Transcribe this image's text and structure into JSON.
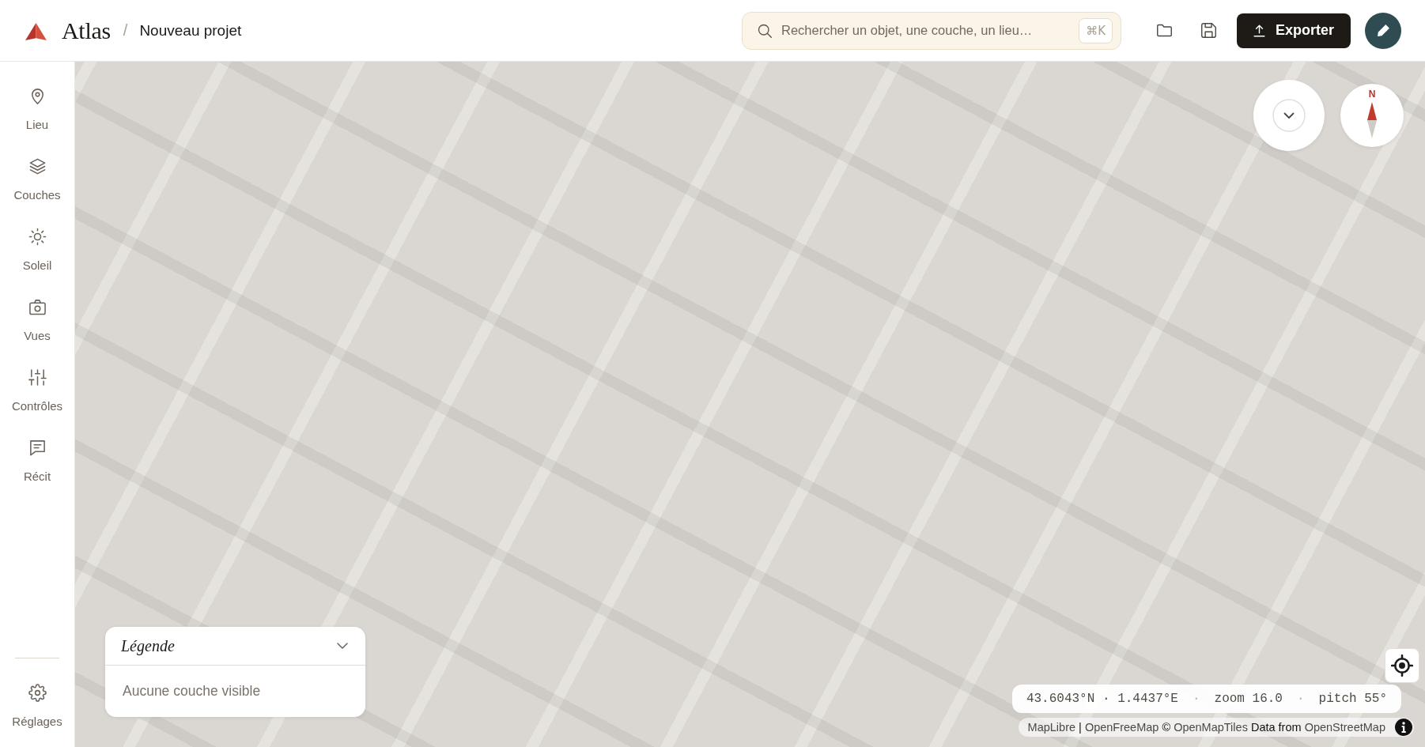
{
  "header": {
    "logo_text": "Atlas",
    "separator": "/",
    "project_name": "Nouveau projet",
    "search": {
      "placeholder": "Rechercher un objet, une couche, un lieu…",
      "shortcut": "⌘K"
    },
    "export_button": "Exporter"
  },
  "sidebar": {
    "items": [
      {
        "label": "Lieu",
        "selected": false
      },
      {
        "label": "Couches",
        "selected": false
      },
      {
        "label": "Soleil",
        "selected": false
      },
      {
        "label": "Vues",
        "selected": false
      },
      {
        "label": "Contrôles",
        "selected": false
      },
      {
        "label": "Récit",
        "selected": false
      }
    ],
    "footer_items": [
      {
        "label": "Réglages",
        "selected": false
      }
    ]
  },
  "map": {
    "compass": {
      "north_label": "N"
    },
    "legend": {
      "title": "Légende",
      "expanded": true,
      "empty_text": "Aucune couche visible"
    },
    "readout": {
      "parts": [
        {
          "kind": "value",
          "text": "43.6043°N · 1.4437°E"
        },
        {
          "kind": "separator",
          "text": "·"
        },
        {
          "kind": "value",
          "text": "zoom 16.0"
        },
        {
          "kind": "separator",
          "text": "·"
        },
        {
          "kind": "value",
          "text": "pitch 55°"
        }
      ]
    },
    "attribution": {
      "parts": [
        {
          "kind": "link",
          "text": "MapLibre"
        },
        {
          "kind": "text",
          "text": "|"
        },
        {
          "kind": "link",
          "text": "OpenFreeMap"
        },
        {
          "kind": "text",
          "text": "©"
        },
        {
          "kind": "link",
          "text": "OpenMapTiles"
        },
        {
          "kind": "text",
          "text": "Data from"
        },
        {
          "kind": "link",
          "text": "OpenStreetMap"
        }
      ]
    }
  }
}
